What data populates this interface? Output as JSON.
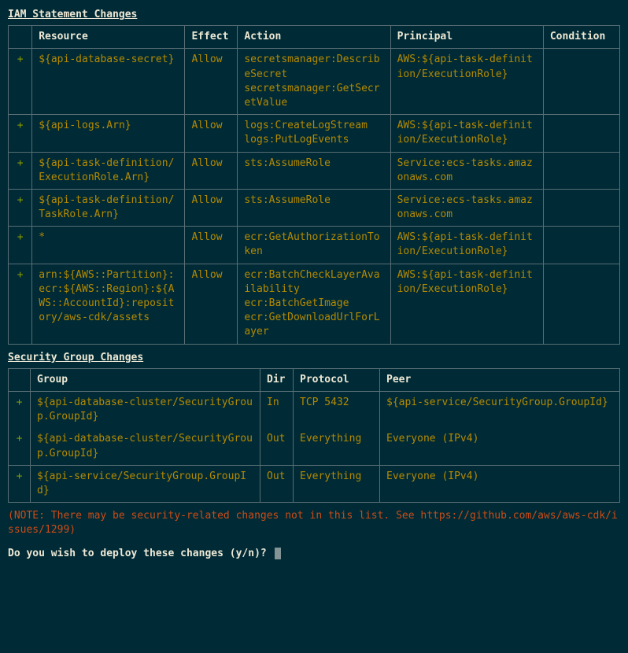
{
  "iam": {
    "title": "IAM Statement Changes",
    "headers": {
      "blank": "",
      "resource": "Resource",
      "effect": "Effect",
      "action": "Action",
      "principal": "Principal",
      "condition": "Condition"
    },
    "rows": [
      {
        "marker": "+",
        "resource": "${api-database-secret}",
        "effect": "Allow",
        "action": "secretsmanager:DescribeSecret\nsecretsmanager:GetSecretValue",
        "principal": "AWS:${api-task-definition/ExecutionRole}",
        "condition": ""
      },
      {
        "marker": "+",
        "resource": "${api-logs.Arn}",
        "effect": "Allow",
        "action": "logs:CreateLogStream\nlogs:PutLogEvents",
        "principal": "AWS:${api-task-definition/ExecutionRole}",
        "condition": ""
      },
      {
        "marker": "+",
        "resource": "${api-task-definition/ExecutionRole.Arn}",
        "effect": "Allow",
        "action": "sts:AssumeRole",
        "principal": "Service:ecs-tasks.amazonaws.com",
        "condition": ""
      },
      {
        "marker": "+",
        "resource": "${api-task-definition/TaskRole.Arn}",
        "effect": "Allow",
        "action": "sts:AssumeRole",
        "principal": "Service:ecs-tasks.amazonaws.com",
        "condition": ""
      },
      {
        "marker": "+",
        "resource": "*",
        "effect": "Allow",
        "action": "ecr:GetAuthorizationToken",
        "principal": "AWS:${api-task-definition/ExecutionRole}",
        "condition": ""
      },
      {
        "marker": "+",
        "resource": "arn:${AWS::Partition}:ecr:${AWS::Region}:${AWS::AccountId}:repository/aws-cdk/assets",
        "effect": "Allow",
        "action": "ecr:BatchCheckLayerAvailability\necr:BatchGetImage\necr:GetDownloadUrlForLayer",
        "principal": "AWS:${api-task-definition/ExecutionRole}",
        "condition": ""
      }
    ]
  },
  "sg": {
    "title": "Security Group Changes",
    "headers": {
      "blank": "",
      "group": "Group",
      "dir": "Dir",
      "protocol": "Protocol",
      "peer": "Peer"
    },
    "groups": [
      [
        {
          "marker": "+",
          "group": "${api-database-cluster/SecurityGroup.GroupId}",
          "dir": "In",
          "protocol": "TCP 5432",
          "peer": "${api-service/SecurityGroup.GroupId}"
        },
        {
          "marker": "+",
          "group": "${api-database-cluster/SecurityGroup.GroupId}",
          "dir": "Out",
          "protocol": "Everything",
          "peer": "Everyone (IPv4)"
        }
      ],
      [
        {
          "marker": "+",
          "group": "${api-service/SecurityGroup.GroupId}",
          "dir": "Out",
          "protocol": "Everything",
          "peer": "Everyone (IPv4)"
        }
      ]
    ]
  },
  "note": "(NOTE: There may be security-related changes not in this list. See https://github.com/aws/aws-cdk/issues/1299)",
  "prompt": "Do you wish to deploy these changes (y/n)? "
}
